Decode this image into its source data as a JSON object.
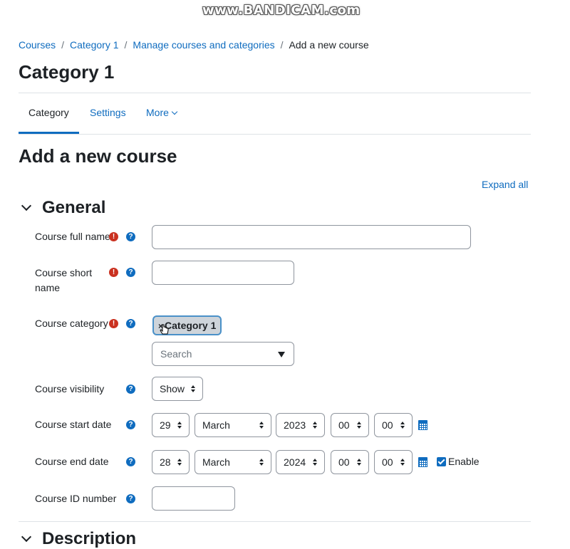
{
  "watermark": "www.BANDICAM.com",
  "breadcrumb": {
    "items": [
      "Courses",
      "Category 1",
      "Manage courses and categories"
    ],
    "current": "Add a new course"
  },
  "page_title": "Category 1",
  "tabs": {
    "category": "Category",
    "settings": "Settings",
    "more": "More"
  },
  "form_title": "Add a new course",
  "expand_all": "Expand all",
  "sections": {
    "general": "General",
    "description": "Description"
  },
  "fields": {
    "full_name": {
      "label": "Course full name",
      "value": ""
    },
    "short_name": {
      "label_line1": "Course short",
      "label_line2": "name",
      "value": ""
    },
    "category": {
      "label": "Course category",
      "chip": "Category 1",
      "chip_remove": "×",
      "search_placeholder": "Search"
    },
    "visibility": {
      "label": "Course visibility",
      "value": "Show"
    },
    "start_date": {
      "label": "Course start date",
      "day": "29",
      "month": "March",
      "year": "2023",
      "hour": "00",
      "minute": "00"
    },
    "end_date": {
      "label": "Course end date",
      "day": "28",
      "month": "March",
      "year": "2024",
      "hour": "00",
      "minute": "00",
      "enable_label": "Enable"
    },
    "id_number": {
      "label": "Course ID number",
      "value": ""
    }
  },
  "icons": {
    "required": "!",
    "help": "?"
  },
  "colors": {
    "link": "#0f6cbf",
    "required": "#ca3120",
    "text": "#1d2125"
  }
}
